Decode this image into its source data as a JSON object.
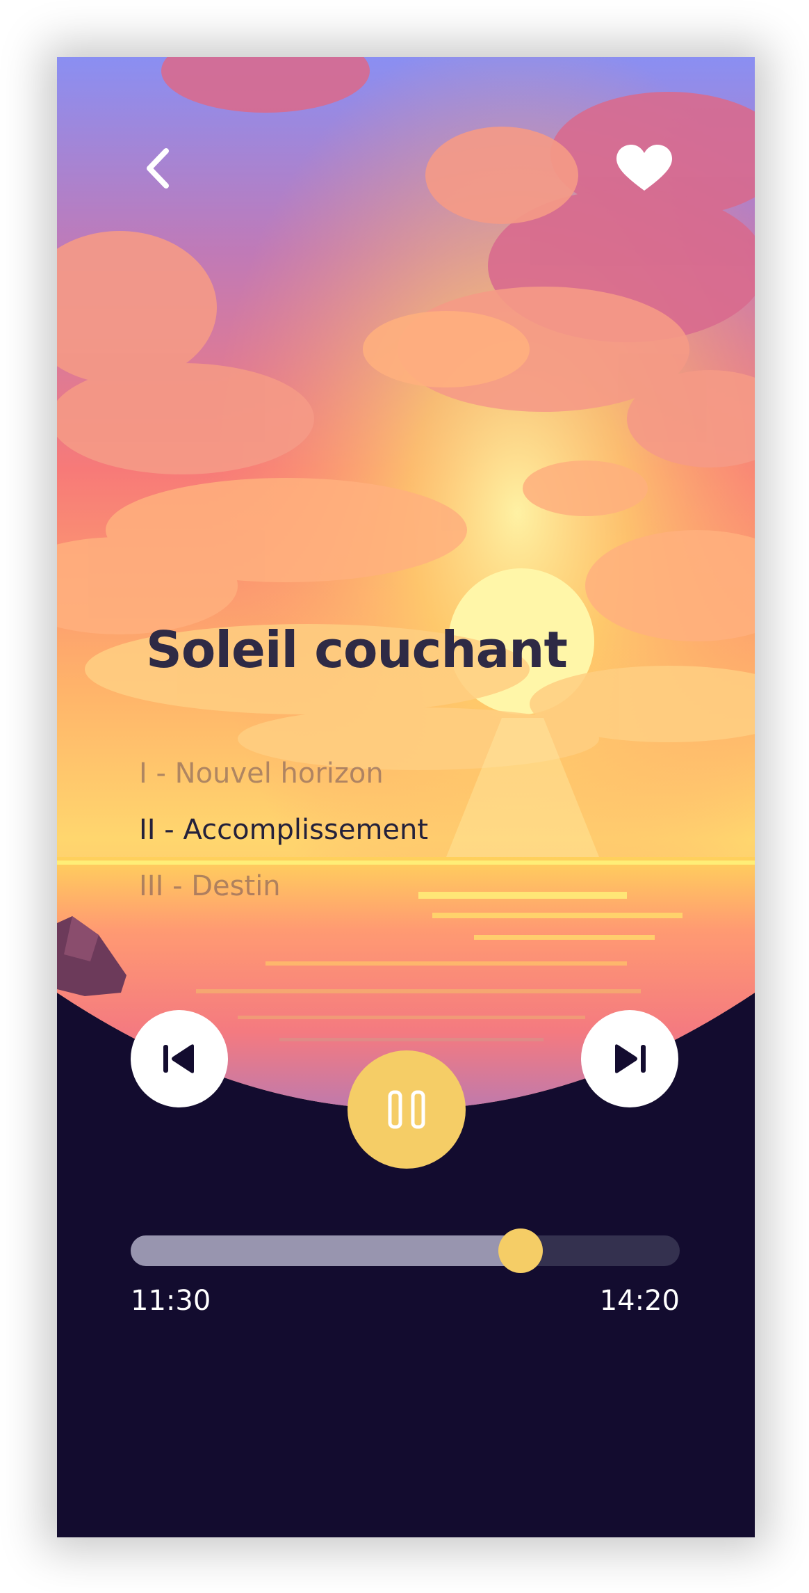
{
  "player": {
    "title": "Soleil couchant",
    "movements": [
      {
        "label": "I - Nouvel horizon",
        "active": false
      },
      {
        "label": "II - Accomplissement",
        "active": true
      },
      {
        "label": "III - Destin",
        "active": false
      }
    ],
    "current_time": "11:30",
    "total_time": "14:20",
    "progress": 0.71
  },
  "icons": {
    "back": "chevron-left-icon",
    "favorite": "heart-icon",
    "previous": "skip-previous-icon",
    "pause": "pause-icon",
    "next": "skip-next-icon"
  },
  "colors": {
    "background": "#130c2f",
    "accent": "#f5cd66",
    "track": "#34314f",
    "track_fill": "#9895af",
    "title": "#2e2a45"
  }
}
